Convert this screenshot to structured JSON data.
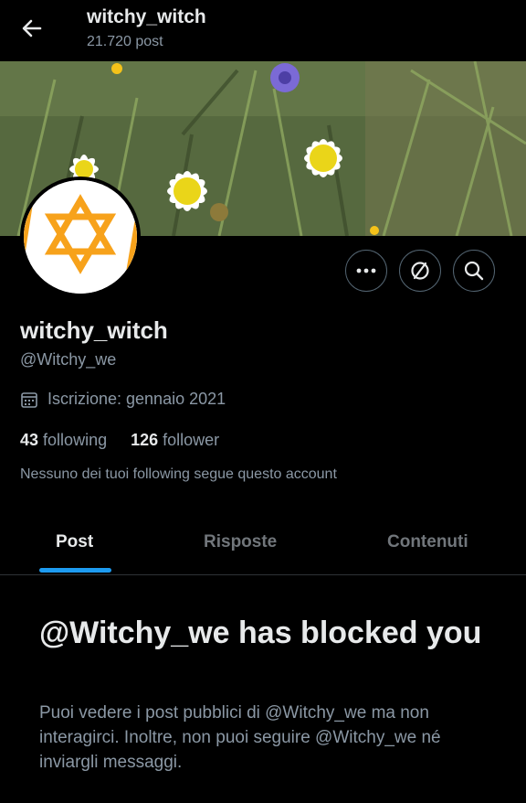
{
  "header": {
    "title": "witchy_witch",
    "post_count": "21.720 post",
    "back_icon": "arrow-left-icon"
  },
  "profile": {
    "name": "witchy_witch",
    "handle": "@Witchy_we",
    "joined": "Iscrizione: gennaio 2021",
    "following_count": "43",
    "following_label": "following",
    "follower_count": "126",
    "follower_label": "follower",
    "mutuals_note": "Nessuno dei tuoi following segue questo account",
    "avatar_colors": {
      "star": "#f7a21b",
      "background": "#ffffff"
    }
  },
  "actions": {
    "more_icon": "more-horizontal-icon",
    "sync_icon": "sync-icon",
    "search_icon": "search-icon"
  },
  "tabs": [
    {
      "label": "Post",
      "active": true
    },
    {
      "label": "Risposte",
      "active": false
    },
    {
      "label": "Contenuti",
      "active": false
    }
  ],
  "blocked": {
    "title": "@Witchy_we has blocked you",
    "message": "Puoi vedere i post pubblici di @Witchy_we ma non interagirci. Inoltre, non puoi seguire @Witchy_we né inviargli messaggi."
  },
  "colors": {
    "accent": "#1d9bf0",
    "text_primary": "#e7e9ea",
    "text_secondary": "#8b98a5",
    "background": "#000000"
  }
}
